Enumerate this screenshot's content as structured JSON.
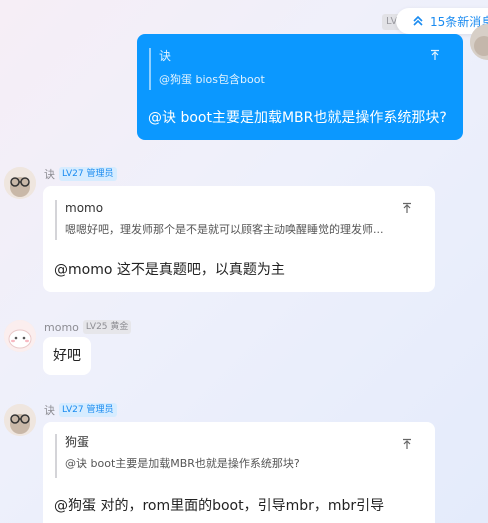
{
  "top": {
    "partial_badge": "LV",
    "new_messages_label": "15条新消息"
  },
  "messages": [
    {
      "side": "self",
      "quote_author": "诀",
      "quote_text": "@狗蛋 bios包含boot",
      "jump_icon": "arrow-up-to-top",
      "text": "@诀 boot主要是加载MBR也就是操作系统那块?"
    },
    {
      "side": "other",
      "sender": "诀",
      "level_badge": "LV27 管理员",
      "quote_author": "momo",
      "quote_text": "嗯嗯好吧，理发师那个是不是就可以顾客主动唤醒睡觉的理发师...",
      "jump_icon": "arrow-up-to-top",
      "text": "@momo 这不是真题吧，以真题为主"
    },
    {
      "side": "other",
      "sender": "momo",
      "level_badge": "LV25 黄金",
      "text": "好吧"
    },
    {
      "side": "other",
      "sender": "诀",
      "level_badge": "LV27 管理员",
      "quote_author": "狗蛋",
      "quote_text": "@诀 boot主要是加载MBR也就是操作系统那块?",
      "jump_icon": "arrow-up-to-top",
      "text": "@狗蛋 对的，rom里面的boot，引导mbr，mbr引导"
    }
  ],
  "colors": {
    "self_bubble": "#0b98ff",
    "accent": "#1a8bf0",
    "manager_badge_bg": "#d6ecff"
  }
}
